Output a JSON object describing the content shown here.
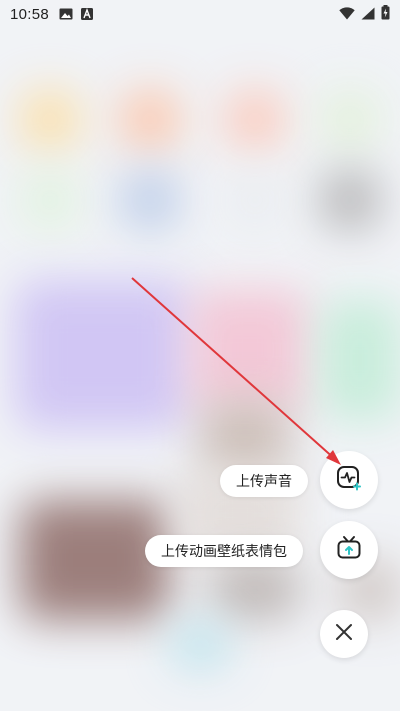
{
  "status_bar": {
    "time": "10:58",
    "left_icons": [
      "image-icon",
      "a-icon"
    ],
    "right_icons": [
      "wifi-icon",
      "signal-icon",
      "battery-charging-icon"
    ]
  },
  "actions": [
    {
      "label": "上传声音",
      "icon": "audio-upload-icon"
    },
    {
      "label": "上传动画壁纸表情包",
      "icon": "tv-upload-icon"
    }
  ],
  "close_icon": "close-icon",
  "colors": {
    "accent_teal": "#2ec4c6",
    "arrow_red": "#e0373b",
    "icon_dark": "#222222"
  }
}
